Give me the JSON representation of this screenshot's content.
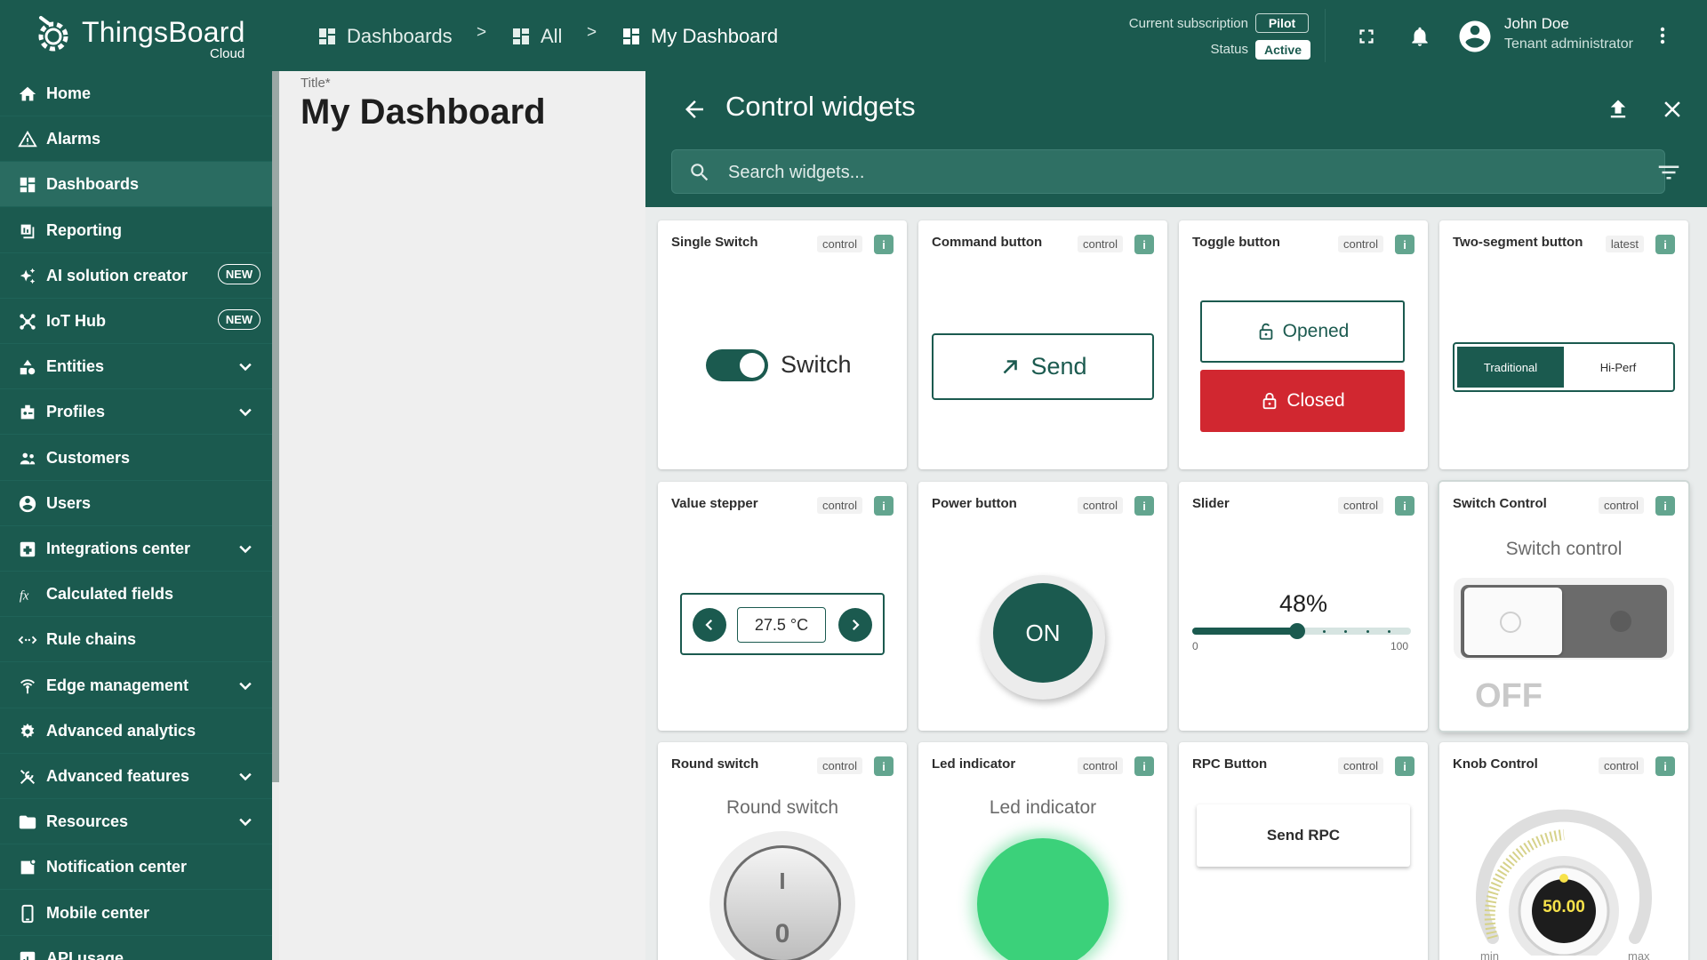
{
  "topbar": {
    "logo_name": "ThingsBoard",
    "logo_sub": "Cloud",
    "breadcrumbs": [
      "Dashboards",
      "All",
      "My Dashboard"
    ],
    "crumb_separator": ">",
    "subscription_label": "Current subscription",
    "subscription_value": "Pilot",
    "status_label": "Status",
    "status_value": "Active",
    "user_name": "John Doe",
    "user_role": "Tenant administrator"
  },
  "sidebar": {
    "items": [
      {
        "label": "Home",
        "icon": "home-icon"
      },
      {
        "label": "Alarms",
        "icon": "warning-icon"
      },
      {
        "label": "Dashboards",
        "icon": "dashboard-icon",
        "selected": true
      },
      {
        "label": "Reporting",
        "icon": "report-icon"
      },
      {
        "label": "AI solution creator",
        "icon": "sparkle-icon",
        "badge": "NEW"
      },
      {
        "label": "IoT Hub",
        "icon": "hub-icon",
        "badge": "NEW"
      },
      {
        "label": "Entities",
        "icon": "entities-icon",
        "expandable": true
      },
      {
        "label": "Profiles",
        "icon": "profiles-icon",
        "expandable": true
      },
      {
        "label": "Customers",
        "icon": "customers-icon"
      },
      {
        "label": "Users",
        "icon": "user-icon"
      },
      {
        "label": "Integrations center",
        "icon": "integrations-icon",
        "expandable": true
      },
      {
        "label": "Calculated fields",
        "icon": "function-icon"
      },
      {
        "label": "Rule chains",
        "icon": "rule-chain-icon"
      },
      {
        "label": "Edge management",
        "icon": "edge-icon",
        "expandable": true
      },
      {
        "label": "Advanced analytics",
        "icon": "analytics-icon"
      },
      {
        "label": "Advanced features",
        "icon": "tools-icon",
        "expandable": true
      },
      {
        "label": "Resources",
        "icon": "folder-icon",
        "expandable": true
      },
      {
        "label": "Notification center",
        "icon": "notification-icon"
      },
      {
        "label": "Mobile center",
        "icon": "mobile-icon"
      },
      {
        "label": "API usage",
        "icon": "api-usage-icon"
      }
    ]
  },
  "dashboard": {
    "title_label": "Title*",
    "title": "My Dashboard"
  },
  "panel": {
    "title": "Control widgets",
    "search_placeholder": "Search widgets...",
    "widgets": [
      {
        "title": "Single Switch",
        "tag": "control",
        "label": "Switch"
      },
      {
        "title": "Command button",
        "tag": "control",
        "label": "Send"
      },
      {
        "title": "Toggle button",
        "tag": "control",
        "opened_label": "Opened",
        "closed_label": "Closed"
      },
      {
        "title": "Two-segment button",
        "tag": "latest",
        "seg1": "Traditional",
        "seg2": "Hi-Perf"
      },
      {
        "title": "Value stepper",
        "tag": "control",
        "value": "27.5 °C"
      },
      {
        "title": "Power button",
        "tag": "control",
        "label": "ON"
      },
      {
        "title": "Slider",
        "tag": "control",
        "value_label": "48%",
        "value": 48,
        "min": "0",
        "max": "100"
      },
      {
        "title": "Switch Control",
        "tag": "control",
        "heading": "Switch control",
        "state": "OFF"
      },
      {
        "title": "Round switch",
        "tag": "control",
        "heading": "Round switch",
        "on_mark": "I",
        "off_mark": "0"
      },
      {
        "title": "Led indicator",
        "tag": "control",
        "heading": "Led indicator"
      },
      {
        "title": "RPC Button",
        "tag": "control",
        "label": "Send RPC"
      },
      {
        "title": "Knob Control",
        "tag": "control",
        "value": "50.00",
        "min": "min",
        "max": "max"
      }
    ],
    "info_mark": "i"
  },
  "colors": {
    "primary": "#1b5a4f",
    "accent_green": "#305a52",
    "danger": "#d12730",
    "led": "#3bd17a",
    "knob_value": "#f7e24a"
  }
}
